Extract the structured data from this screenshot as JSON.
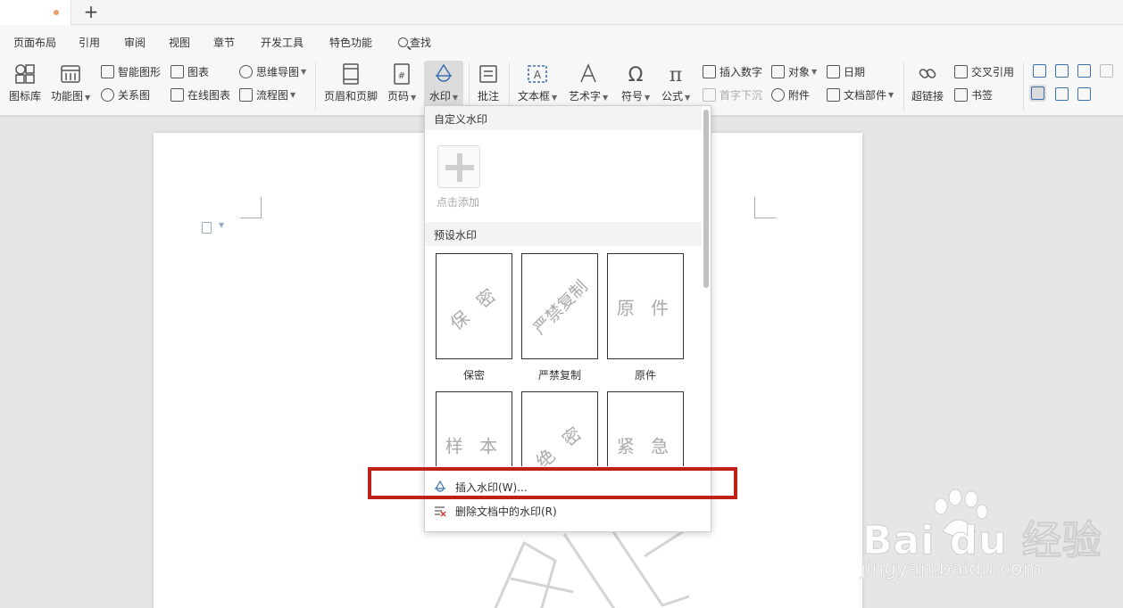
{
  "tabbar": {
    "add_symbol": "+"
  },
  "menu": {
    "items": [
      "页面布局",
      "引用",
      "审阅",
      "视图",
      "章节",
      "开发工具",
      "特色功能"
    ],
    "search_label": "查找"
  },
  "ribbon": {
    "icon_library": "图标库",
    "function_chart": "功能图",
    "smart_shape": "智能图形",
    "relation_chart": "关系图",
    "chart": "图表",
    "online_chart": "在线图表",
    "mind_map": "思维导图",
    "flow_chart": "流程图",
    "header_footer": "页眉和页脚",
    "page_number": "页码",
    "watermark": "水印",
    "comment": "批注",
    "text_box": "文本框",
    "word_art": "艺术字",
    "symbol": "符号",
    "formula": "公式",
    "insert_number": "插入数字",
    "drop_cap": "首字下沉",
    "object": "对象",
    "attachment": "附件",
    "date": "日期",
    "doc_parts": "文档部件",
    "hyperlink": "超链接",
    "cross_reference": "交叉引用",
    "bookmark": "书签"
  },
  "dropdown": {
    "custom_header": "自定义水印",
    "add_label": "点击添加",
    "preset_header": "预设水印",
    "presets": [
      {
        "text": "保 密",
        "label": "保密"
      },
      {
        "text": "严禁复制",
        "label": "严禁复制"
      },
      {
        "text": "原 件",
        "label": "原件"
      },
      {
        "text": "样 本",
        "label": ""
      },
      {
        "text": "绝 密",
        "label": ""
      },
      {
        "text": "紧 急",
        "label": ""
      }
    ],
    "insert_watermark": "插入水印(W)...",
    "remove_watermark": "删除文档中的水印(R)"
  },
  "baidu": {
    "logo": "Bai  du 经验",
    "url": "jingyan.baidu.com"
  },
  "colors": {
    "highlight": "#c0201a",
    "tab_dot": "#f0a06a"
  }
}
